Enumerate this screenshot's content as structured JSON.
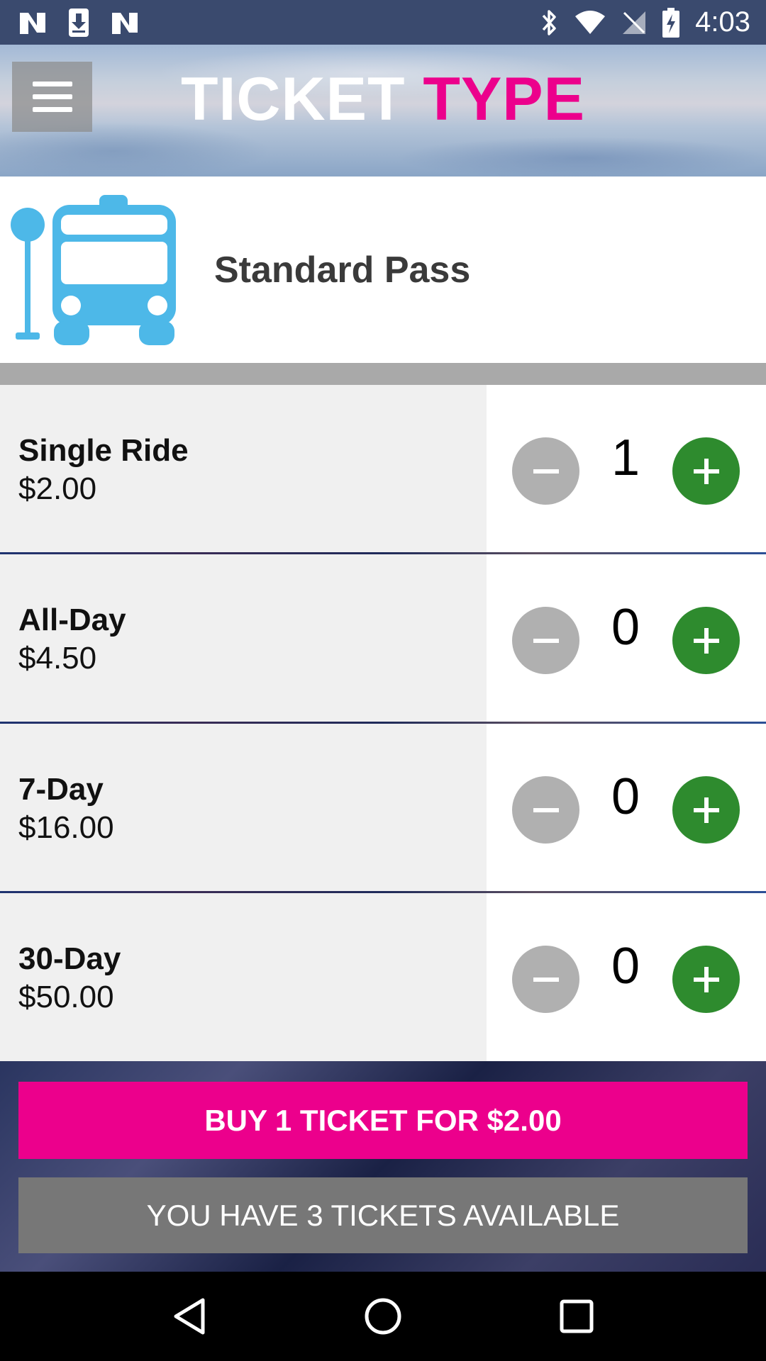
{
  "status_bar": {
    "time": "4:03",
    "left_icons": [
      "n-icon",
      "download-icon",
      "n-icon"
    ],
    "right_icons": [
      "bluetooth-icon",
      "wifi-icon",
      "no-sim-icon",
      "battery-charging-icon"
    ]
  },
  "header": {
    "title_part1": "TICKET",
    "title_part2": "TYPE"
  },
  "pass": {
    "name": "Standard Pass",
    "icon": "bus-stop-icon"
  },
  "tickets": [
    {
      "name": "Single Ride",
      "price": "$2.00",
      "quantity": "1"
    },
    {
      "name": "All-Day",
      "price": "$4.50",
      "quantity": "0"
    },
    {
      "name": "7-Day",
      "price": "$16.00",
      "quantity": "0"
    },
    {
      "name": "30-Day",
      "price": "$50.00",
      "quantity": "0"
    }
  ],
  "actions": {
    "buy_label": "BUY 1 TICKET FOR $2.00",
    "available_label": "YOU HAVE 3 TICKETS AVAILABLE"
  },
  "colors": {
    "accent_pink": "#ec008c",
    "plus_green": "#2e8b2e",
    "minus_gray": "#b0b0b0",
    "bus_blue": "#4db8e8"
  }
}
